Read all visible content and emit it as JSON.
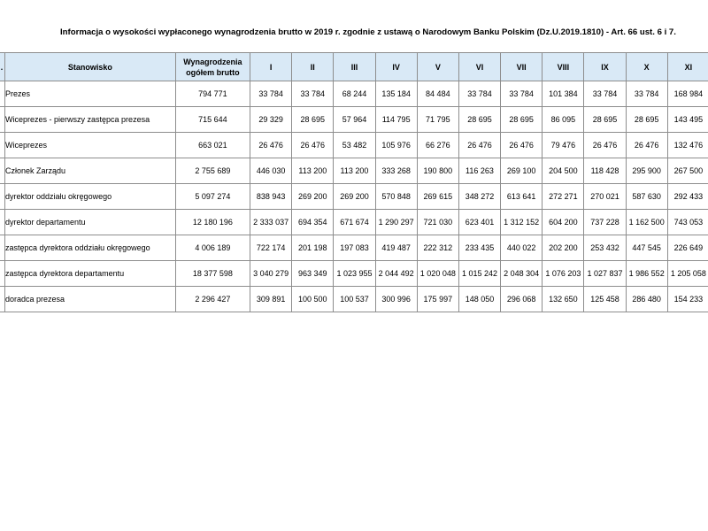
{
  "title": "Informacja o wysokości wypłaconego wynagrodzenia brutto w 2019 r. zgodnie z ustawą o Narodowym Banku Polskim (Dz.U.2019.1810) - Art. 66 ust. 6 i 7.",
  "table": {
    "headers": {
      "lp": ".",
      "position": "Stanowisko",
      "total": "Wynagrodzenia ogółem brutto",
      "months": [
        "I",
        "II",
        "III",
        "IV",
        "V",
        "VI",
        "VII",
        "VIII",
        "IX",
        "X",
        "XI"
      ]
    },
    "rows": [
      {
        "position": "Prezes",
        "total": "794 771",
        "months": [
          "33 784",
          "33 784",
          "68 244",
          "135 184",
          "84 484",
          "33 784",
          "33 784",
          "101 384",
          "33 784",
          "33 784",
          "168 984"
        ]
      },
      {
        "position": "Wiceprezes - pierwszy zastępca prezesa",
        "total": "715 644",
        "months": [
          "29 329",
          "28 695",
          "57 964",
          "114 795",
          "71 795",
          "28 695",
          "28 695",
          "86 095",
          "28 695",
          "28 695",
          "143 495"
        ]
      },
      {
        "position": "Wiceprezes",
        "total": "663 021",
        "months": [
          "26 476",
          "26 476",
          "53 482",
          "105 976",
          "66 276",
          "26 476",
          "26 476",
          "79 476",
          "26 476",
          "26 476",
          "132 476"
        ]
      },
      {
        "position": "Członek Zarządu",
        "total": "2 755 689",
        "months": [
          "446 030",
          "113 200",
          "113 200",
          "333 268",
          "190 800",
          "116 263",
          "269 100",
          "204 500",
          "118 428",
          "295 900",
          "267 500"
        ]
      },
      {
        "position": "dyrektor oddziału okręgowego",
        "total": "5 097 274",
        "months": [
          "838 943",
          "269 200",
          "269 200",
          "570 848",
          "269 615",
          "348 272",
          "613 641",
          "272 271",
          "270 021",
          "587 630",
          "292 433"
        ]
      },
      {
        "position": "dyrektor departamentu",
        "total": "12 180 196",
        "months": [
          "2 333 037",
          "694 354",
          "671 674",
          "1 290 297",
          "721 030",
          "623 401",
          "1 312 152",
          "604 200",
          "737 228",
          "1 162 500",
          "743 053"
        ]
      },
      {
        "position": "zastępca dyrektora oddziału okręgowego",
        "total": "4 006 189",
        "months": [
          "722 174",
          "201 198",
          "197 083",
          "419 487",
          "222 312",
          "233 435",
          "440 022",
          "202 200",
          "253 432",
          "447 545",
          "226 649"
        ]
      },
      {
        "position": "zastępca dyrektora departamentu",
        "total": "18 377 598",
        "months": [
          "3 040 279",
          "963 349",
          "1 023 955",
          "2 044 492",
          "1 020 048",
          "1 015 242",
          "2 048 304",
          "1 076 203",
          "1 027 837",
          "1 986 552",
          "1 205 058"
        ]
      },
      {
        "position": "doradca prezesa",
        "total": "2 296 427",
        "months": [
          "309 891",
          "100 500",
          "100 537",
          "300 996",
          "175 997",
          "148 050",
          "296 068",
          "132 650",
          "125 458",
          "286 480",
          "154 233"
        ]
      }
    ]
  }
}
